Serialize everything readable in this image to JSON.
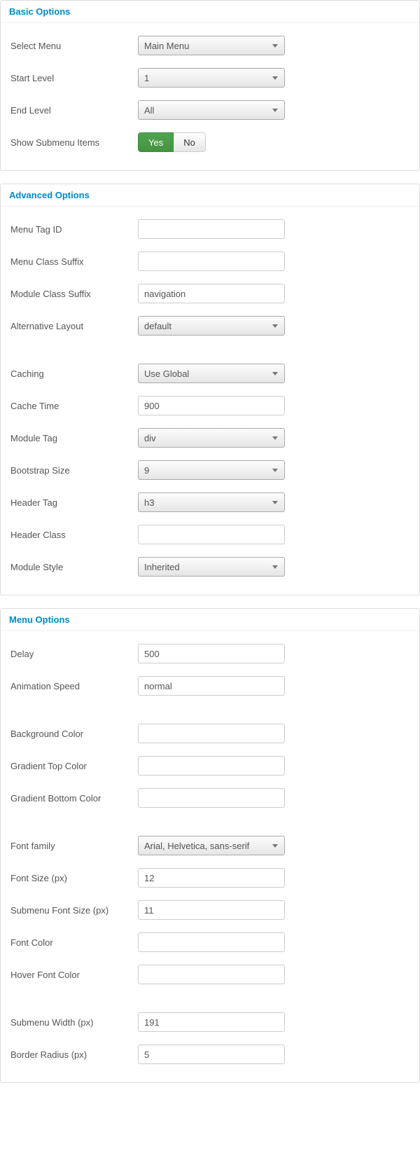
{
  "basic": {
    "title": "Basic Options",
    "select_menu": {
      "label": "Select Menu",
      "value": "Main Menu"
    },
    "start_level": {
      "label": "Start Level",
      "value": "1"
    },
    "end_level": {
      "label": "End Level",
      "value": "All"
    },
    "show_submenu": {
      "label": "Show Submenu Items",
      "yes": "Yes",
      "no": "No",
      "value": "Yes"
    }
  },
  "advanced": {
    "title": "Advanced Options",
    "menu_tag_id": {
      "label": "Menu Tag ID",
      "value": ""
    },
    "menu_class_suffix": {
      "label": "Menu Class Suffix",
      "value": ""
    },
    "module_class_suffix": {
      "label": "Module Class Suffix",
      "value": "navigation"
    },
    "alternative_layout": {
      "label": "Alternative Layout",
      "value": "default"
    },
    "caching": {
      "label": "Caching",
      "value": "Use Global"
    },
    "cache_time": {
      "label": "Cache Time",
      "value": "900"
    },
    "module_tag": {
      "label": "Module Tag",
      "value": "div"
    },
    "bootstrap_size": {
      "label": "Bootstrap Size",
      "value": "9"
    },
    "header_tag": {
      "label": "Header Tag",
      "value": "h3"
    },
    "header_class": {
      "label": "Header Class",
      "value": ""
    },
    "module_style": {
      "label": "Module Style",
      "value": "Inherited"
    }
  },
  "menu": {
    "title": "Menu Options",
    "delay": {
      "label": "Delay",
      "value": "500"
    },
    "animation_speed": {
      "label": "Animation Speed",
      "value": "normal"
    },
    "background_color": {
      "label": "Background Color",
      "value": ""
    },
    "gradient_top": {
      "label": "Gradient Top Color",
      "value": ""
    },
    "gradient_bottom": {
      "label": "Gradient Bottom Color",
      "value": ""
    },
    "font_family": {
      "label": "Font family",
      "value": "Arial, Helvetica, sans-serif"
    },
    "font_size": {
      "label": "Font Size (px)",
      "value": "12"
    },
    "submenu_font_size": {
      "label": "Submenu Font Size (px)",
      "value": "11"
    },
    "font_color": {
      "label": "Font Color",
      "value": ""
    },
    "hover_font_color": {
      "label": "Hover Font Color",
      "value": ""
    },
    "submenu_width": {
      "label": "Submenu Width (px)",
      "value": "191"
    },
    "border_radius": {
      "label": "Border Radius (px)",
      "value": "5"
    }
  }
}
